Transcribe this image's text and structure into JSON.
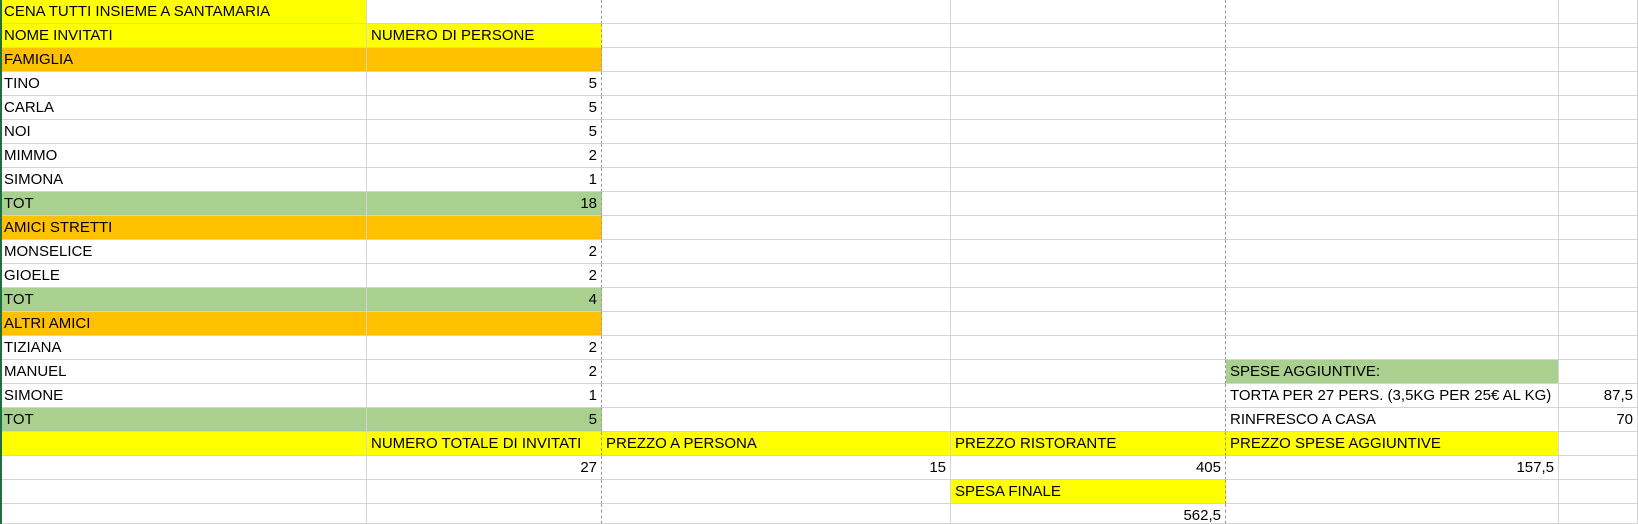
{
  "sheet": {
    "rows": [
      [
        {
          "t": "CENA TUTTI INSIEME A SANTAMARIA",
          "bg": "yellow"
        },
        {
          "t": ""
        },
        {
          "t": ""
        },
        {
          "t": ""
        },
        {
          "t": ""
        },
        {
          "t": ""
        }
      ],
      [
        {
          "t": "NOME INVITATI",
          "bg": "yellow"
        },
        {
          "t": "NUMERO DI PERSONE",
          "bg": "yellow"
        },
        {
          "t": ""
        },
        {
          "t": ""
        },
        {
          "t": ""
        },
        {
          "t": ""
        }
      ],
      [
        {
          "t": "FAMIGLIA",
          "bg": "orange"
        },
        {
          "t": "",
          "bg": "orange"
        },
        {
          "t": ""
        },
        {
          "t": ""
        },
        {
          "t": ""
        },
        {
          "t": ""
        }
      ],
      [
        {
          "t": "TINO"
        },
        {
          "t": "5",
          "num": true
        },
        {
          "t": ""
        },
        {
          "t": ""
        },
        {
          "t": ""
        },
        {
          "t": ""
        }
      ],
      [
        {
          "t": "CARLA"
        },
        {
          "t": "5",
          "num": true
        },
        {
          "t": ""
        },
        {
          "t": ""
        },
        {
          "t": ""
        },
        {
          "t": ""
        }
      ],
      [
        {
          "t": "NOI"
        },
        {
          "t": "5",
          "num": true
        },
        {
          "t": ""
        },
        {
          "t": ""
        },
        {
          "t": ""
        },
        {
          "t": ""
        }
      ],
      [
        {
          "t": "MIMMO"
        },
        {
          "t": "2",
          "num": true
        },
        {
          "t": ""
        },
        {
          "t": ""
        },
        {
          "t": ""
        },
        {
          "t": ""
        }
      ],
      [
        {
          "t": "SIMONA"
        },
        {
          "t": "1",
          "num": true
        },
        {
          "t": ""
        },
        {
          "t": ""
        },
        {
          "t": ""
        },
        {
          "t": ""
        }
      ],
      [
        {
          "t": "TOT",
          "bg": "green"
        },
        {
          "t": "18",
          "num": true,
          "bg": "green"
        },
        {
          "t": ""
        },
        {
          "t": ""
        },
        {
          "t": ""
        },
        {
          "t": ""
        }
      ],
      [
        {
          "t": "AMICI STRETTI",
          "bg": "orange"
        },
        {
          "t": "",
          "bg": "orange"
        },
        {
          "t": ""
        },
        {
          "t": ""
        },
        {
          "t": ""
        },
        {
          "t": ""
        }
      ],
      [
        {
          "t": "MONSELICE"
        },
        {
          "t": "2",
          "num": true
        },
        {
          "t": ""
        },
        {
          "t": ""
        },
        {
          "t": ""
        },
        {
          "t": ""
        }
      ],
      [
        {
          "t": "GIOELE"
        },
        {
          "t": "2",
          "num": true
        },
        {
          "t": ""
        },
        {
          "t": ""
        },
        {
          "t": ""
        },
        {
          "t": ""
        }
      ],
      [
        {
          "t": "TOT",
          "bg": "green"
        },
        {
          "t": "4",
          "num": true,
          "bg": "green"
        },
        {
          "t": ""
        },
        {
          "t": ""
        },
        {
          "t": ""
        },
        {
          "t": ""
        }
      ],
      [
        {
          "t": "ALTRI AMICI",
          "bg": "orange"
        },
        {
          "t": "",
          "bg": "orange"
        },
        {
          "t": ""
        },
        {
          "t": ""
        },
        {
          "t": ""
        },
        {
          "t": ""
        }
      ],
      [
        {
          "t": "TIZIANA"
        },
        {
          "t": "2",
          "num": true
        },
        {
          "t": ""
        },
        {
          "t": ""
        },
        {
          "t": ""
        },
        {
          "t": ""
        }
      ],
      [
        {
          "t": "MANUEL"
        },
        {
          "t": "2",
          "num": true
        },
        {
          "t": ""
        },
        {
          "t": ""
        },
        {
          "t": "SPESE AGGIUNTIVE:",
          "bg": "green"
        },
        {
          "t": ""
        }
      ],
      [
        {
          "t": "SIMONE"
        },
        {
          "t": "1",
          "num": true
        },
        {
          "t": ""
        },
        {
          "t": ""
        },
        {
          "t": "TORTA PER 27 PERS. (3,5KG PER 25€ AL KG)"
        },
        {
          "t": "87,5",
          "num": true
        }
      ],
      [
        {
          "t": "TOT",
          "bg": "green"
        },
        {
          "t": "5",
          "num": true,
          "bg": "green"
        },
        {
          "t": ""
        },
        {
          "t": ""
        },
        {
          "t": "RINFRESCO A CASA"
        },
        {
          "t": "70",
          "num": true
        }
      ],
      [
        {
          "t": "",
          "bg": "yellow"
        },
        {
          "t": "NUMERO TOTALE DI INVITATI",
          "bg": "yellow"
        },
        {
          "t": "PREZZO A PERSONA",
          "bg": "yellow"
        },
        {
          "t": "PREZZO RISTORANTE",
          "bg": "yellow"
        },
        {
          "t": "PREZZO SPESE AGGIUNTIVE",
          "bg": "yellow"
        },
        {
          "t": ""
        }
      ],
      [
        {
          "t": ""
        },
        {
          "t": "27",
          "num": true
        },
        {
          "t": "15",
          "num": true
        },
        {
          "t": "405",
          "num": true
        },
        {
          "t": "157,5",
          "num": true
        },
        {
          "t": ""
        }
      ],
      [
        {
          "t": ""
        },
        {
          "t": ""
        },
        {
          "t": ""
        },
        {
          "t": "SPESA FINALE",
          "bg": "yellow"
        },
        {
          "t": ""
        },
        {
          "t": ""
        }
      ],
      [
        {
          "t": ""
        },
        {
          "t": ""
        },
        {
          "t": ""
        },
        {
          "t": "562,5",
          "num": true
        },
        {
          "t": ""
        },
        {
          "t": ""
        }
      ]
    ]
  }
}
